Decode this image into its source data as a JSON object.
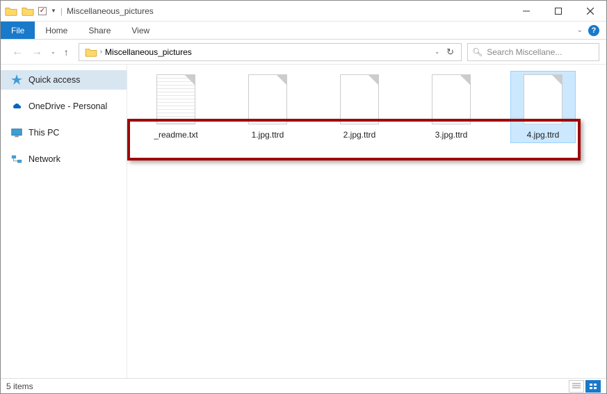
{
  "title": "Miscellaneous_pictures",
  "ribbon": {
    "file": "File",
    "home": "Home",
    "share": "Share",
    "view": "View"
  },
  "address": {
    "crumb": "Miscellaneous_pictures"
  },
  "search": {
    "placeholder": "Search Miscellane..."
  },
  "sidebar": {
    "quickaccess": "Quick access",
    "onedrive": "OneDrive - Personal",
    "thispc": "This PC",
    "network": "Network"
  },
  "files": [
    {
      "name": "_readme.txt",
      "type": "text",
      "selected": false
    },
    {
      "name": "1.jpg.ttrd",
      "type": "generic",
      "selected": false
    },
    {
      "name": "2.jpg.ttrd",
      "type": "generic",
      "selected": false
    },
    {
      "name": "3.jpg.ttrd",
      "type": "generic",
      "selected": false
    },
    {
      "name": "4.jpg.ttrd",
      "type": "generic",
      "selected": true
    }
  ],
  "status": {
    "count": "5 items"
  }
}
